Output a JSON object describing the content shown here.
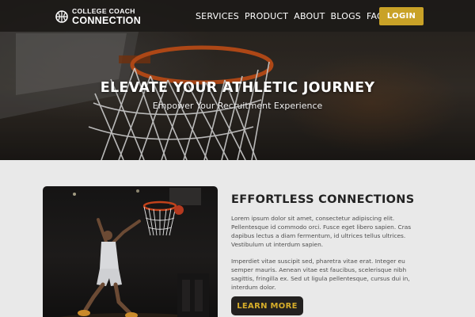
{
  "brand": {
    "line1": "COLLEGE COACH",
    "line2": "CONNECTION",
    "icon": "basketball-icon"
  },
  "nav": {
    "items": [
      "SERVICES",
      "PRODUCT",
      "ABOUT",
      "BLOGS",
      "FAQ'S"
    ],
    "login_label": "LOGIN"
  },
  "hero": {
    "title": "ELEVATE YOUR ATHLETIC JOURNEY",
    "subtitle": "Empower Your Recruitment Experience"
  },
  "feature": {
    "title": "EFFORTLESS CONNECTIONS",
    "paragraph1": "Lorem ipsum dolor sit amet, consectetur adipiscing elit. Pellentesque id commodo orci. Fusce eget libero sapien. Cras dapibus lectus a diam fermentum, id ultrices tellus ultrices. Vestibulum ut interdum sapien.",
    "paragraph2": "Imperdiet vitae suscipit sed, pharetra vitae erat. Integer eu semper mauris. Aenean vitae est faucibus, scelerisque nibh sagittis, fringilla ex. Sed ut ligula pellentesque, cursus dui in, interdum dolor.",
    "button_label": "LEARN MORE"
  },
  "colors": {
    "accent": "#c9a227",
    "nav_bg": "#1c1a18",
    "section_bg": "#e9e9e9",
    "button_dark": "#232120"
  }
}
